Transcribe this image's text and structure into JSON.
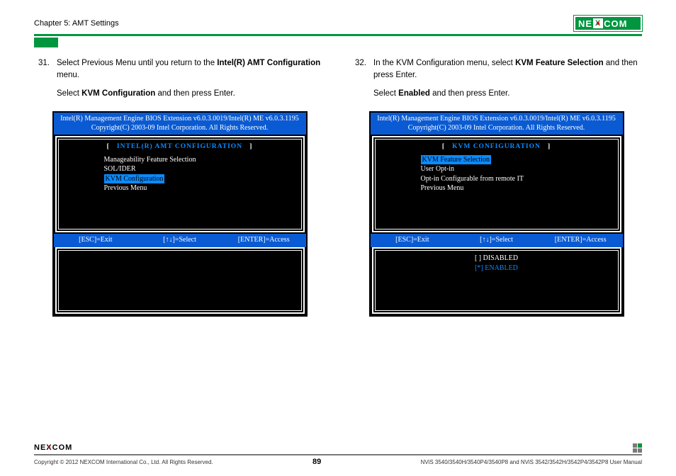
{
  "header": {
    "chapter": "Chapter 5: AMT Settings",
    "logo_text_left": "NE",
    "logo_text_right": "COM"
  },
  "left": {
    "num": "31.",
    "p1a": "Select Previous Menu until you return to the ",
    "p1b": "Intel(R) AMT Configuration",
    "p1c": " menu.",
    "p2a": "Select ",
    "p2b": "KVM Configuration",
    "p2c": " and then press Enter.",
    "bios": {
      "head1": "Intel(R) Management Engine BIOS Extension v6.0.3.0019/Intel(R) ME v6.0.3.1195",
      "head2": "Copyright(C) 2003-09 Intel Corporation. All Rights Reserved.",
      "title": "INTEL(R) AMT CONFIGURATION",
      "items": {
        "i1": "Manageability Feature Selection",
        "i2": "SOL/IDER",
        "i3": "KVM Configuration",
        "i4": "Previous Menu"
      },
      "keys": {
        "k1": "[ESC]=Exit",
        "k2": "[↑↓]=Select",
        "k3": "[ENTER]=Access"
      }
    }
  },
  "right": {
    "num": "32.",
    "p1a": "In the KVM Configuration menu, select ",
    "p1b": "KVM Feature Selection",
    "p1c": " and then press Enter.",
    "p2a": "Select ",
    "p2b": "Enabled",
    "p2c": " and then press Enter.",
    "bios": {
      "head1": "Intel(R) Management Engine BIOS Extension v6.0.3.0019/Intel(R) ME v6.0.3.1195",
      "head2": "Copyright(C) 2003-09 Intel Corporation. All Rights Reserved.",
      "title": "KVM CONFIGURATION",
      "items": {
        "i1": "KVM Feature Selection",
        "i2": "User Opt-in",
        "i3": "Opt-in Configurable from remote IT",
        "i4": "Previous Menu"
      },
      "keys": {
        "k1": "[ESC]=Exit",
        "k2": "[↑↓]=Select",
        "k3": "[ENTER]=Access"
      },
      "opts": {
        "dis": "[  ] DISABLED",
        "en": "[*] ENABLED"
      }
    }
  },
  "footer": {
    "copyright": "Copyright © 2012 NEXCOM International Co., Ltd. All Rights Reserved.",
    "page": "89",
    "manual": "NViS 3540/3540H/3540P4/3540P8 and NViS 3542/3542H/3542P4/3542P8 User Manual"
  }
}
